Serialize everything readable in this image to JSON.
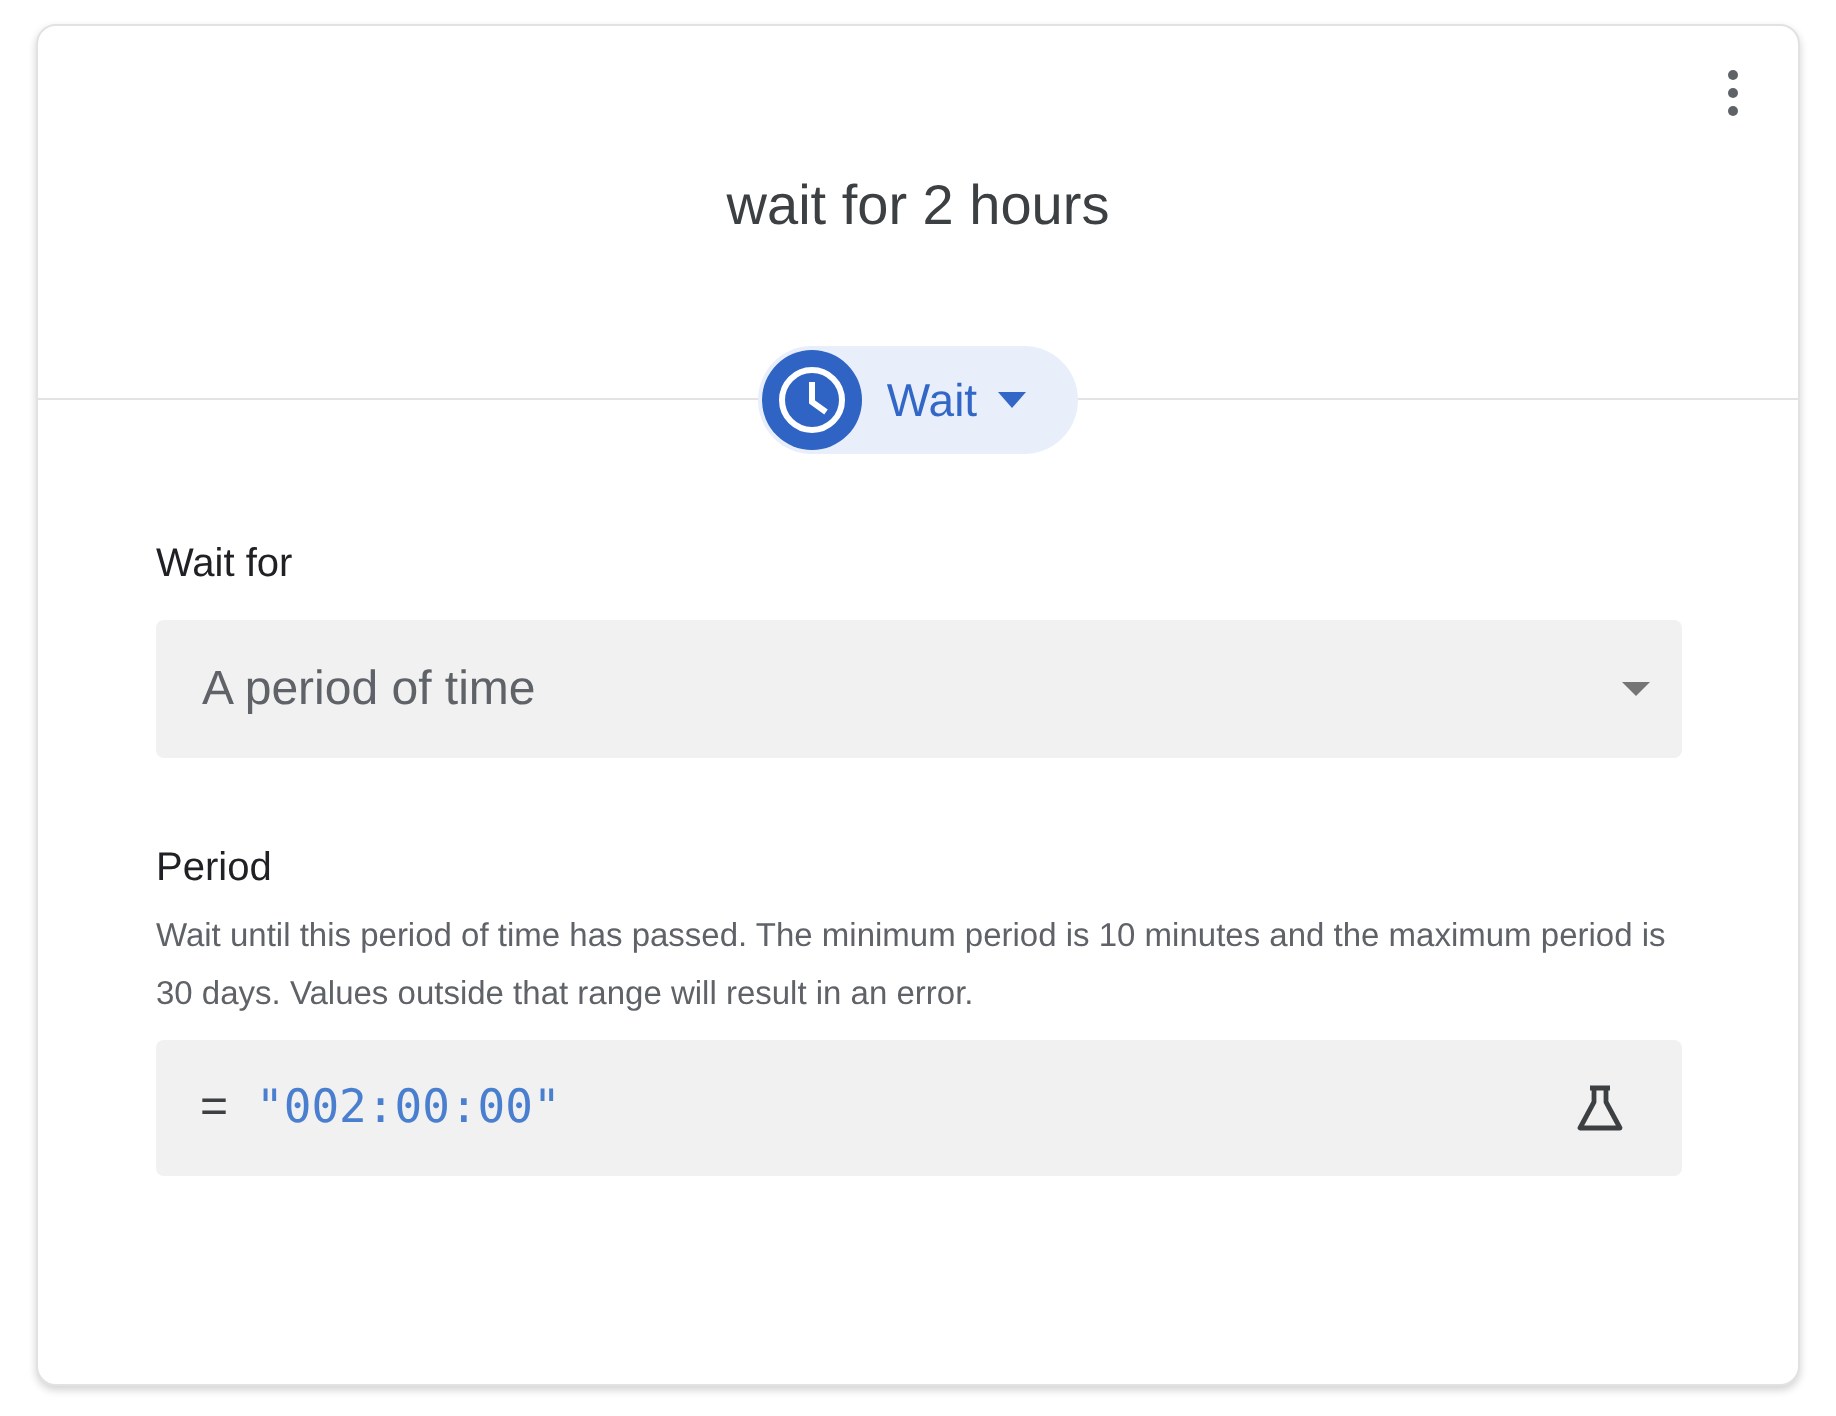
{
  "card": {
    "title": "wait for 2 hours",
    "step_chip": {
      "label": "Wait"
    },
    "wait_for": {
      "label": "Wait for",
      "value": "A period of time"
    },
    "period": {
      "label": "Period",
      "description": "Wait until this period of time has passed. The minimum period is 10 minutes and the maximum period is 30 days. Values outside that range will result in an error.",
      "operator": "=",
      "value": "\"002:00:00\""
    }
  }
}
